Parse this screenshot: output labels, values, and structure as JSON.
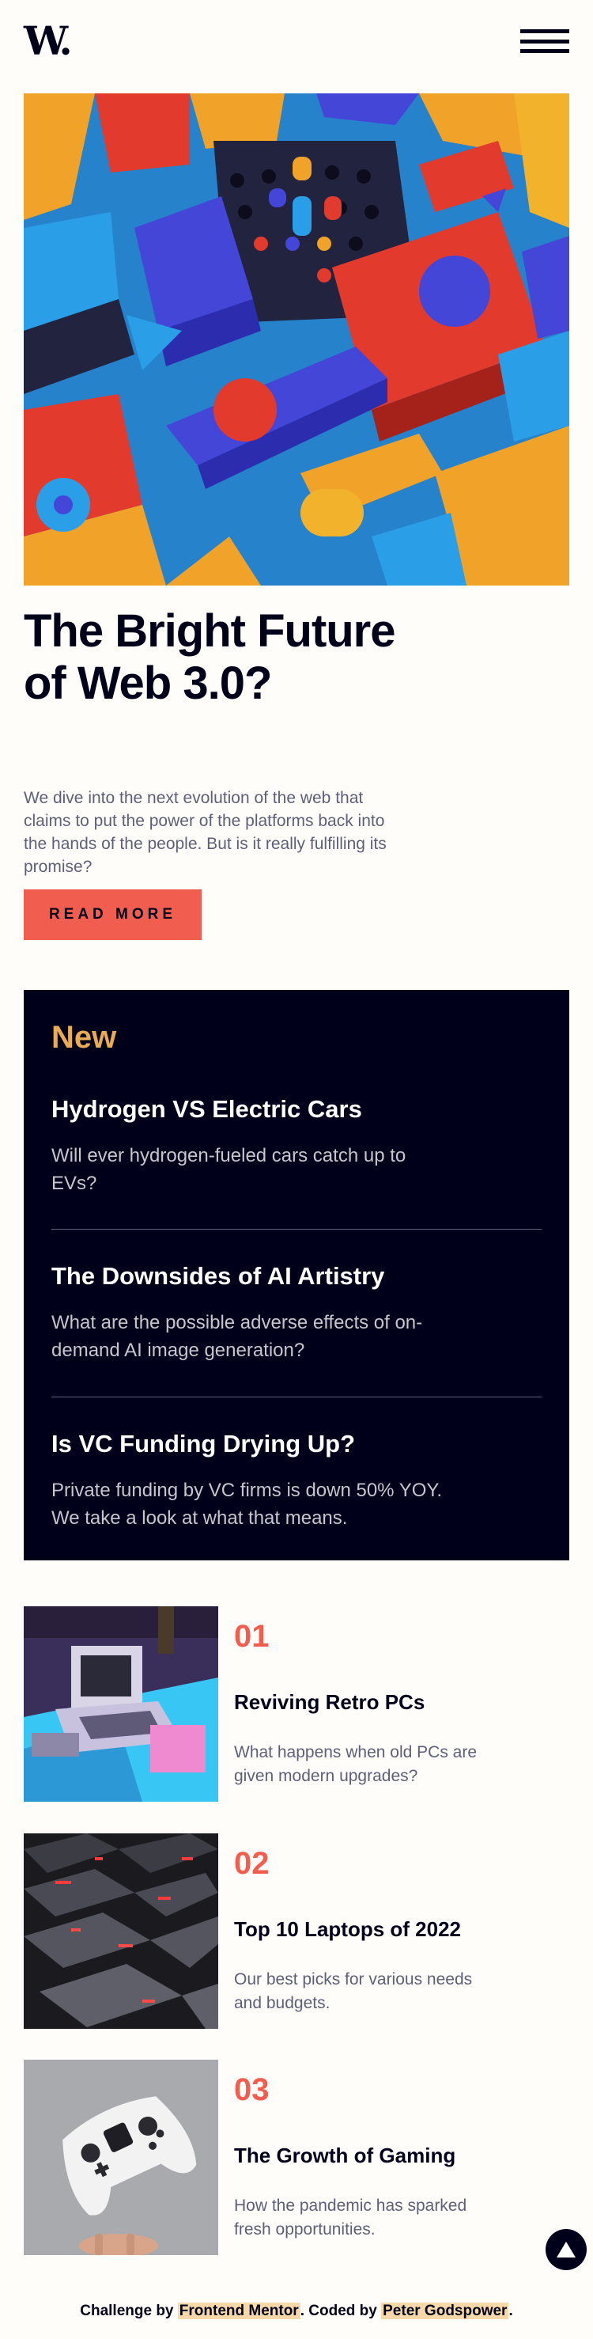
{
  "header": {
    "logo": "W.",
    "menu_icon": "hamburger-menu-icon"
  },
  "hero": {
    "image_alt": "abstract 3D geometric shapes",
    "title": "The Bright Future of Web 3.0?",
    "description": "We dive into the next evolution of the web that claims to put the power of the platforms back into the hands of the people. But is it really fulfilling its promise?",
    "button_label": "READ MORE"
  },
  "new_section": {
    "heading": "New",
    "items": [
      {
        "title": "Hydrogen VS Electric Cars",
        "description": "Will ever hydrogen-fueled cars catch up to EVs?"
      },
      {
        "title": "The Downsides of AI Artistry",
        "description": "What are the possible adverse effects of on-demand AI image generation?"
      },
      {
        "title": "Is VC Funding Drying Up?",
        "description": "Private funding by VC firms is down 50% YOY. We take a look at what that means."
      }
    ]
  },
  "articles": [
    {
      "number": "01",
      "title": "Reviving Retro PCs",
      "description": "What happens when old PCs are given modern upgrades?"
    },
    {
      "number": "02",
      "title": "Top 10 Laptops of 2022",
      "description": "Our best picks for various needs and budgets."
    },
    {
      "number": "03",
      "title": "The Growth of Gaming",
      "description": "How the pandemic has sparked fresh opportunities."
    }
  ],
  "footer": {
    "prefix": "Challenge by",
    "challenge_link": "Frontend Mentor",
    "middle": ". Coded by",
    "author_link": "Peter Godspower",
    "suffix": "."
  },
  "colors": {
    "background": "#fffdf9",
    "dark": "#00001a",
    "accent_red": "#f15e50",
    "accent_orange": "#e9ab53",
    "muted": "#5d5f79"
  },
  "scroll_top_icon": "triangle-up-icon"
}
